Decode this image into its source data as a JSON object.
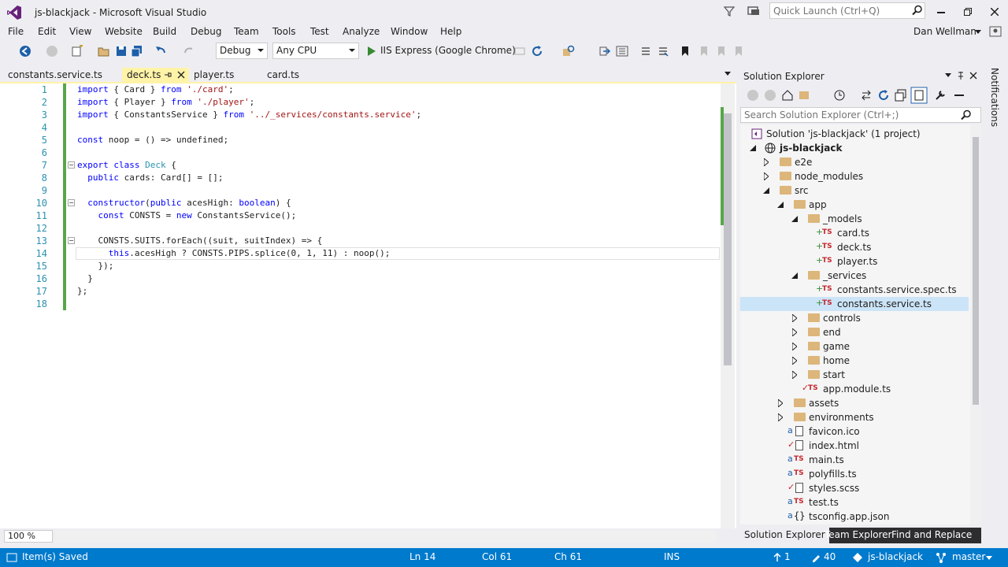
{
  "window": {
    "title": "js-blackjack - Microsoft Visual Studio",
    "quick_launch_placeholder": "Quick Launch (Ctrl+Q)"
  },
  "menu": [
    "File",
    "Edit",
    "View",
    "Website",
    "Build",
    "Debug",
    "Team",
    "Tools",
    "Test",
    "Analyze",
    "Window",
    "Help"
  ],
  "user": "Dan Wellman",
  "toolbar": {
    "config": "Debug",
    "platform": "Any CPU",
    "run_target": "IIS Express (Google Chrome)"
  },
  "tabs": [
    {
      "label": "constants.service.ts"
    },
    {
      "label": "deck.ts",
      "active": true
    },
    {
      "label": "player.ts"
    },
    {
      "label": "card.ts"
    }
  ],
  "editor": {
    "line_numbers": [
      "1",
      "2",
      "3",
      "4",
      "5",
      "6",
      "7",
      "8",
      "9",
      "10",
      "11",
      "12",
      "13",
      "14",
      "15",
      "16",
      "17",
      "18"
    ],
    "zoom": "100 %"
  },
  "solution_explorer": {
    "title": "Solution Explorer",
    "search_placeholder": "Search Solution Explorer (Ctrl+;)",
    "items": [
      {
        "label": "Solution 'js-blackjack' (1 project)"
      },
      {
        "label": "js-blackjack"
      },
      {
        "label": "e2e"
      },
      {
        "label": "node_modules"
      },
      {
        "label": "src"
      },
      {
        "label": "app"
      },
      {
        "label": "_models"
      },
      {
        "label": "card.ts"
      },
      {
        "label": "deck.ts"
      },
      {
        "label": "player.ts"
      },
      {
        "label": "_services"
      },
      {
        "label": "constants.service.spec.ts"
      },
      {
        "label": "constants.service.ts"
      },
      {
        "label": "controls"
      },
      {
        "label": "end"
      },
      {
        "label": "game"
      },
      {
        "label": "home"
      },
      {
        "label": "start"
      },
      {
        "label": "app.module.ts"
      },
      {
        "label": "assets"
      },
      {
        "label": "environments"
      },
      {
        "label": "favicon.ico"
      },
      {
        "label": "index.html"
      },
      {
        "label": "main.ts"
      },
      {
        "label": "polyfills.ts"
      },
      {
        "label": "styles.scss"
      },
      {
        "label": "test.ts"
      },
      {
        "label": "tsconfig.app.json"
      }
    ],
    "bottom_tabs": [
      "Solution Explorer",
      "Team Explorer",
      "Find and Replace"
    ]
  },
  "notifications_label": "Notifications",
  "status": {
    "message": "Item(s) Saved",
    "line": "Ln 14",
    "col": "Col 61",
    "ch": "Ch 61",
    "mode": "INS",
    "up_count": "1",
    "pencil_count": "40",
    "repo": "js-blackjack",
    "branch": "master"
  }
}
